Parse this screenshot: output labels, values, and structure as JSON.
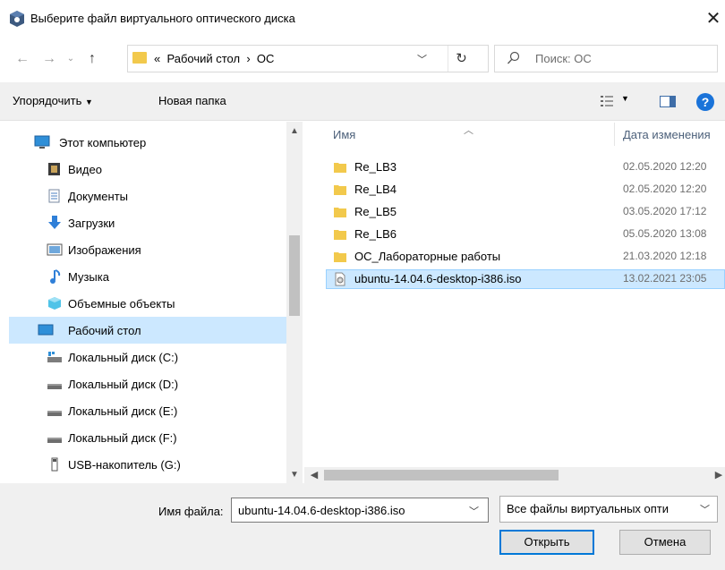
{
  "window": {
    "title": "Выберите файл виртуального оптического диска",
    "close_glyph": "✕"
  },
  "address": {
    "prefix": "«",
    "path": [
      "Рабочий стол",
      "ОС"
    ],
    "separator": "›",
    "search_placeholder": "Поиск: ОС"
  },
  "toolbar": {
    "organize_label": "Упорядочить",
    "new_folder_label": "Новая папка"
  },
  "nav": {
    "items": [
      {
        "label": "Этот компьютер",
        "icon": "computer-icon"
      },
      {
        "label": "Видео",
        "icon": "video-icon"
      },
      {
        "label": "Документы",
        "icon": "documents-icon"
      },
      {
        "label": "Загрузки",
        "icon": "downloads-icon"
      },
      {
        "label": "Изображения",
        "icon": "pictures-icon"
      },
      {
        "label": "Музыка",
        "icon": "music-icon"
      },
      {
        "label": "Объемные объекты",
        "icon": "3d-objects-icon"
      },
      {
        "label": "Рабочий стол",
        "icon": "desktop-icon",
        "selected": true
      },
      {
        "label": "Локальный диск (C:)",
        "icon": "system-drive-icon"
      },
      {
        "label": "Локальный диск (D:)",
        "icon": "drive-icon"
      },
      {
        "label": "Локальный диск (E:)",
        "icon": "drive-icon"
      },
      {
        "label": "Локальный диск (F:)",
        "icon": "drive-icon"
      },
      {
        "label": "USB-накопитель (G:)",
        "icon": "usb-drive-icon"
      }
    ]
  },
  "columns": {
    "name": "Имя",
    "date": "Дата изменения"
  },
  "files": [
    {
      "name": "Re_LB3",
      "date": "02.05.2020 12:20",
      "type": "folder"
    },
    {
      "name": "Re_LB4",
      "date": "02.05.2020 12:20",
      "type": "folder"
    },
    {
      "name": "Re_LB5",
      "date": "03.05.2020 17:12",
      "type": "folder"
    },
    {
      "name": "Re_LB6",
      "date": "05.05.2020 13:08",
      "type": "folder"
    },
    {
      "name": "ОС_Лабораторные работы",
      "date": "21.03.2020 12:18",
      "type": "folder"
    },
    {
      "name": "ubuntu-14.04.6-desktop-i386.iso",
      "date": "13.02.2021 23:05",
      "type": "iso",
      "selected": true
    }
  ],
  "bottom": {
    "filename_label": "Имя файла:",
    "filename_value": "ubuntu-14.04.6-desktop-i386.iso",
    "filter_value": "Все файлы виртуальных опти",
    "open_label": "Открыть",
    "cancel_label": "Отмена"
  },
  "colors": {
    "accent": "#0078d7",
    "selection": "#cce8ff",
    "folder": "#f2c94c"
  }
}
